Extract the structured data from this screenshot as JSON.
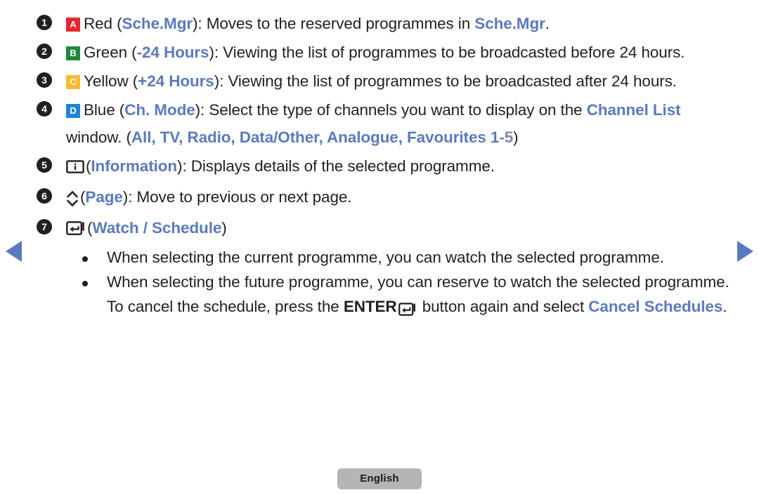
{
  "nav": {
    "prev_arrow": "left-triangle",
    "next_arrow": "right-triangle"
  },
  "items": [
    {
      "number": "1",
      "key": {
        "letter": "A",
        "color": "#e8262d",
        "name": "red"
      },
      "segments": [
        {
          "text": "Red (",
          "style": "plain"
        },
        {
          "text": "Sche.Mgr",
          "style": "blue"
        },
        {
          "text": "): Moves to the reserved programmes in ",
          "style": "plain"
        },
        {
          "text": "Sche.Mgr",
          "style": "blue"
        },
        {
          "text": ".",
          "style": "plain"
        }
      ],
      "plain_text": "Red (Sche.Mgr): Moves to the reserved programmes in Sche.Mgr."
    },
    {
      "number": "2",
      "key": {
        "letter": "B",
        "color": "#1e8a3c",
        "name": "green"
      },
      "segments": [
        {
          "text": "Green (",
          "style": "plain"
        },
        {
          "text": "-24 Hours",
          "style": "blue"
        },
        {
          "text": "): Viewing the list of programmes to be broadcasted before 24 hours.",
          "style": "plain"
        }
      ],
      "plain_text": "Green (-24 Hours): Viewing the list of programmes to be broadcasted before 24 hours."
    },
    {
      "number": "3",
      "key": {
        "letter": "C",
        "color": "#fcba30",
        "name": "yellow"
      },
      "segments": [
        {
          "text": "Yellow (",
          "style": "plain"
        },
        {
          "text": "+24 Hours",
          "style": "blue"
        },
        {
          "text": "): Viewing the list of programmes to be broadcasted after 24 hours.",
          "style": "plain"
        }
      ],
      "plain_text": "Yellow (+24 Hours): Viewing the list of programmes to be broadcasted after 24 hours."
    },
    {
      "number": "4",
      "key": {
        "letter": "D",
        "color": "#2383d4",
        "name": "blue"
      },
      "segments": [
        {
          "text": "Blue (",
          "style": "plain"
        },
        {
          "text": "Ch. Mode",
          "style": "blue"
        },
        {
          "text": "): Select the type of channels you want to display on the ",
          "style": "plain"
        },
        {
          "text": "Channel List",
          "style": "blue"
        },
        {
          "text": " window. (",
          "style": "plain"
        },
        {
          "text": "All, TV, Radio, Data/Other, Analogue, Favourites 1",
          "style": "blue"
        },
        {
          "text": "-5",
          "style": "dim"
        },
        {
          "text": ")",
          "style": "plain"
        }
      ],
      "plain_text": "Blue (Ch. Mode): Select the type of channels you want to display on the Channel List window. (All, TV, Radio, Data/Other, Analogue, Favourites 1-5)"
    },
    {
      "number": "5",
      "icon": "information-icon",
      "segments": [
        {
          "text": "(",
          "style": "plain"
        },
        {
          "text": "Information",
          "style": "blue"
        },
        {
          "text": "): Displays details of the selected programme.",
          "style": "plain"
        }
      ],
      "plain_text": "(Information): Displays details of the selected programme."
    },
    {
      "number": "6",
      "icon": "page-up-down-icon",
      "segments": [
        {
          "text": "(",
          "style": "plain"
        },
        {
          "text": "Page",
          "style": "blue"
        },
        {
          "text": "): Move to previous or next page.",
          "style": "plain"
        }
      ],
      "plain_text": "(Page): Move to previous or next page."
    },
    {
      "number": "7",
      "icon": "enter-key-icon",
      "segments": [
        {
          "text": "(",
          "style": "plain"
        },
        {
          "text": "Watch / Schedule",
          "style": "blue"
        },
        {
          "text": ")",
          "style": "plain"
        }
      ],
      "plain_text": "(Watch / Schedule)"
    }
  ],
  "sub_items": [
    {
      "segments": [
        {
          "text": "When selecting the current programme, you can watch the selected programme.",
          "style": "plain"
        }
      ],
      "plain_text": "When selecting the current programme, you can watch the selected programme."
    },
    {
      "segments": [
        {
          "text": "When selecting the future programme, you can reserve to watch the selected programme. To cancel the schedule, press the ",
          "style": "plain"
        },
        {
          "text": "ENTER",
          "style": "bold-black"
        },
        {
          "text": "enter-key-icon",
          "style": "icon"
        },
        {
          "text": " button again and select ",
          "style": "plain"
        },
        {
          "text": "Cancel Schedules",
          "style": "blue"
        },
        {
          "text": ".",
          "style": "plain"
        }
      ],
      "plain_text": "When selecting the future programme, you can reserve to watch the selected programme. To cancel the schedule, press the ENTER button again and select Cancel Schedules."
    }
  ],
  "footer": {
    "language_label": "English"
  },
  "colors": {
    "accent_blue": "#5b79bf",
    "text": "#231f20",
    "key_red": "#e8262d",
    "key_green": "#1e8a3c",
    "key_yellow": "#fcba30",
    "key_blue": "#2383d4",
    "button_gray": "#b5b5b5"
  }
}
